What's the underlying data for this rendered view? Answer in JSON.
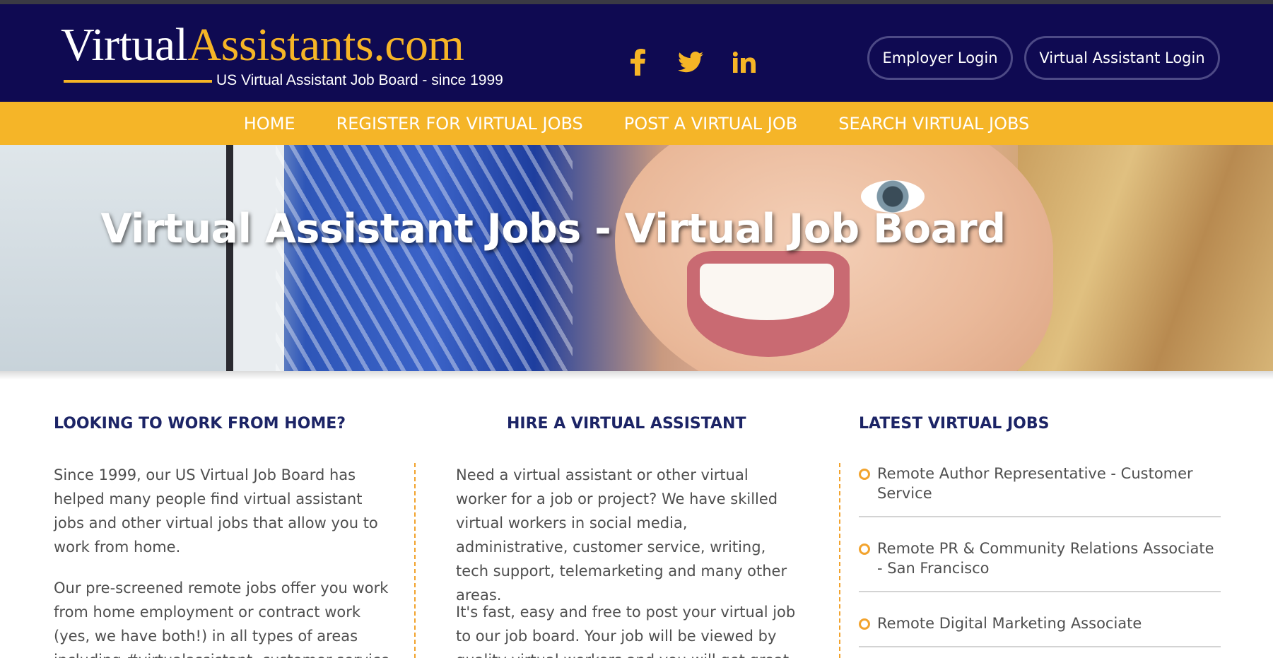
{
  "header": {
    "logo": {
      "part1": "Virtual",
      "part2": "Assistants.com",
      "tagline": "US Virtual Assistant Job Board - since 1999"
    },
    "social": [
      {
        "name": "facebook-icon",
        "glyph": "f"
      },
      {
        "name": "twitter-icon"
      },
      {
        "name": "linkedin-icon",
        "glyph": "in"
      }
    ],
    "employer_login": "Employer Login",
    "va_login": "Virtual Assistant Login",
    "colors": {
      "navy": "#0f0a52",
      "gold": "#f6b526"
    }
  },
  "nav": {
    "items": [
      "HOME",
      "REGISTER FOR VIRTUAL JOBS",
      "POST A VIRTUAL JOB",
      "SEARCH VIRTUAL JOBS"
    ]
  },
  "hero": {
    "title": "Virtual Assistant Jobs - Virtual Job Board"
  },
  "columns": {
    "work": {
      "title": "LOOKING TO WORK FROM HOME?",
      "p1": "Since 1999, our US Virtual Job Board has helped many people find virtual assistant jobs and other virtual jobs that allow you to work from home.",
      "p2": "Our pre-screened remote jobs offer you work from home employment or contract work (yes, we have both!) in all types of areas including #virtualassistant, customer service,"
    },
    "hire": {
      "title": "HIRE A VIRTUAL ASSISTANT",
      "p1": "Need a virtual assistant or other virtual worker for a job or project? We have skilled virtual workers in social media, administrative, customer service, writing, tech support, telemarketing and many other areas.",
      "p2": "It's fast, easy and free to post your virtual job to our job board. Your job will be viewed by quality virtual workers and you will get great"
    },
    "latest": {
      "title": "LATEST VIRTUAL JOBS",
      "jobs": [
        "Remote Author Representative - Customer Service",
        "Remote PR & Community Relations Associate - San Francisco",
        "Remote Digital Marketing Associate"
      ]
    }
  }
}
